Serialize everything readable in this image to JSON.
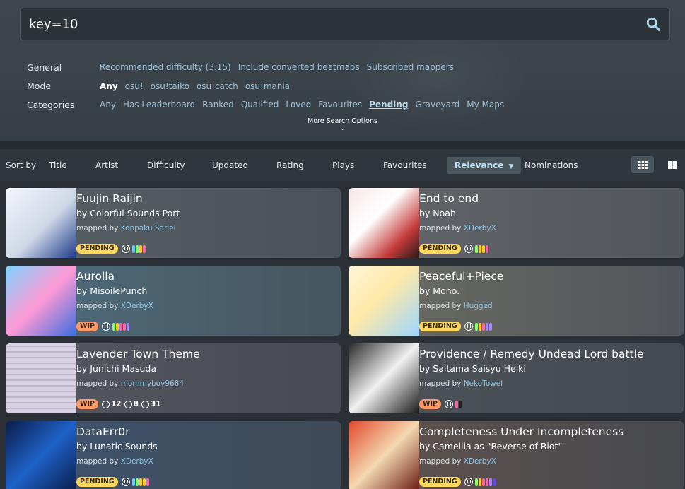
{
  "search": {
    "query": "key=10"
  },
  "filters": {
    "general": {
      "label": "General",
      "options": [
        "Recommended difficulty (3.15)",
        "Include converted beatmaps",
        "Subscribed mappers"
      ]
    },
    "mode": {
      "label": "Mode",
      "options": [
        "Any",
        "osu!",
        "osu!taiko",
        "osu!catch",
        "osu!mania"
      ],
      "active": "Any"
    },
    "categories": {
      "label": "Categories",
      "options": [
        "Any",
        "Has Leaderboard",
        "Ranked",
        "Qualified",
        "Loved",
        "Favourites",
        "Pending",
        "Graveyard",
        "My Maps"
      ],
      "active": "Pending"
    },
    "more_options": "More Search Options"
  },
  "sort": {
    "label": "Sort by",
    "options": [
      "Title",
      "Artist",
      "Difficulty",
      "Updated",
      "Rating",
      "Plays",
      "Favourites",
      "Relevance",
      "Nominations"
    ],
    "active": "Relevance"
  },
  "colors": {
    "pending": "#ffd75e",
    "wip": "#ff9a66",
    "link": "#8dc6e6"
  },
  "cards": [
    {
      "title": "Fuujin Raijin",
      "artist": "by Colorful Sounds Port",
      "mapped_by": "mapped by",
      "mapper": "Konpaku Sariel",
      "status": "PENDING",
      "diffs": [
        "#66ccff",
        "#88ff66",
        "#ffcc22",
        "#ff66aa"
      ],
      "cover_icon": "",
      "stats": []
    },
    {
      "title": "End to end",
      "artist": "by Noah",
      "mapped_by": "mapped by",
      "mapper": "XDerbyX",
      "status": "PENDING",
      "diffs": [
        "#88ff66",
        "#ffcc22",
        "#ffcc22",
        "#ff66aa"
      ],
      "stats": []
    },
    {
      "title": "Aurolla",
      "artist": "by MisoilePunch",
      "mapped_by": "mapped by",
      "mapper": "XDerbyX",
      "status": "WIP",
      "diffs": [
        "#88ff66",
        "#ffcc22",
        "#ff66aa",
        "#ff66aa",
        "#aa88ff"
      ],
      "stats": []
    },
    {
      "title": "Peaceful+Piece",
      "artist": "by Mono.",
      "mapped_by": "mapped by",
      "mapper": "Hugged",
      "status": "PENDING",
      "diffs": [
        "#88ff66",
        "#ffcc22",
        "#ff66aa",
        "#aa88ff",
        "#aa88ff"
      ],
      "stats": []
    },
    {
      "title": "Lavender Town Theme",
      "artist": "by Junichi Masuda",
      "mapped_by": "mapped by",
      "mapper": "mommyboy9684",
      "status": "WIP",
      "diffs": [],
      "stats": [
        {
          "icon": "std-icon",
          "value": "12"
        },
        {
          "icon": "taiko-icon",
          "value": "8"
        },
        {
          "icon": "mania-icon",
          "value": "31"
        }
      ]
    },
    {
      "title": "Providence / Remedy Undead Lord battle",
      "artist": "by Saitama Saisyu Heiki",
      "mapped_by": "mapped by",
      "mapper": "NekoTowel",
      "status": "WIP",
      "diffs": [
        "#ff66aa",
        "#222222"
      ],
      "stats": []
    },
    {
      "title": "DataErr0r",
      "artist": "by Lunatic Sounds",
      "mapped_by": "mapped by",
      "mapper": "XDerbyX",
      "status": "PENDING",
      "diffs": [
        "#66ccff",
        "#88ff66",
        "#ffcc22",
        "#ffcc22",
        "#ff66aa"
      ],
      "stats": []
    },
    {
      "title": "Completeness Under Incompleteness",
      "artist": "by Camellia as \"Reverse of Riot\"",
      "mapped_by": "mapped by",
      "mapper": "XDerbyX",
      "status": "PENDING",
      "diffs": [
        "#88ff66",
        "#ffcc22",
        "#ff66aa",
        "#ff66aa",
        "#aa88ff",
        "#6644ff"
      ],
      "stats": []
    }
  ]
}
